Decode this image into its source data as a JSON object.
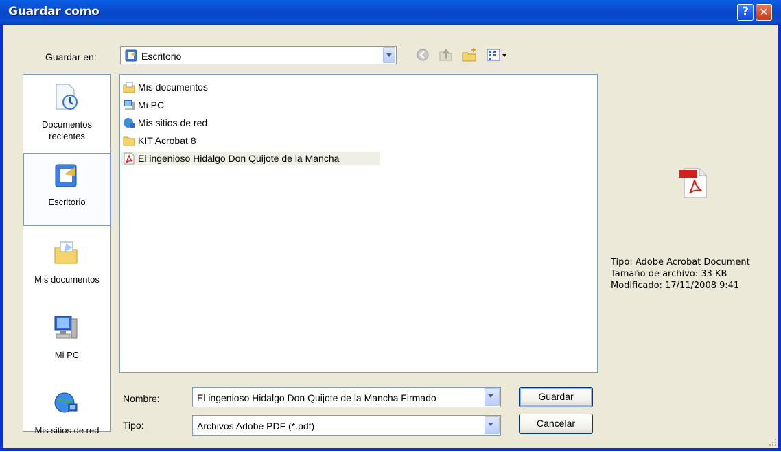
{
  "window": {
    "title": "Guardar como",
    "help_glyph": "?",
    "close_glyph": "✕"
  },
  "toolbar": {
    "save_in_label": "Guardar en:",
    "location": "Escritorio",
    "icons": [
      "back-icon",
      "up-folder-icon",
      "new-folder-icon",
      "view-menu-icon"
    ]
  },
  "places": [
    {
      "label": "Documentos recientes",
      "icon": "recent-documents-icon"
    },
    {
      "label": "Escritorio",
      "icon": "desktop-icon",
      "selected": true
    },
    {
      "label": "Mis documentos",
      "icon": "my-documents-icon"
    },
    {
      "label": "Mi PC",
      "icon": "my-computer-icon"
    },
    {
      "label": "Mis sitios de red",
      "icon": "network-places-icon"
    }
  ],
  "files": [
    {
      "name": "Mis documentos",
      "icon": "my-documents-icon"
    },
    {
      "name": "Mi PC",
      "icon": "my-computer-icon"
    },
    {
      "name": "Mis sitios de red",
      "icon": "network-places-icon"
    },
    {
      "name": "KIT Acrobat 8",
      "icon": "folder-icon"
    },
    {
      "name": "El ingenioso Hidalgo Don Quijote de la Mancha",
      "icon": "pdf-file-icon",
      "highlighted": true
    }
  ],
  "preview": {
    "icon": "pdf-file-icon",
    "type": "Tipo: Adobe Acrobat Document",
    "size": "Tamaño de archivo: 33 KB",
    "modified": "Modificado: 17/11/2008 9:41"
  },
  "form": {
    "name_label": "Nombre:",
    "name_value": "El ingenioso Hidalgo Don Quijote de la Mancha Firmado",
    "type_label": "Tipo:",
    "type_value": "Archivos Adobe PDF (*.pdf)"
  },
  "buttons": {
    "save": "Guardar",
    "cancel": "Cancelar"
  }
}
